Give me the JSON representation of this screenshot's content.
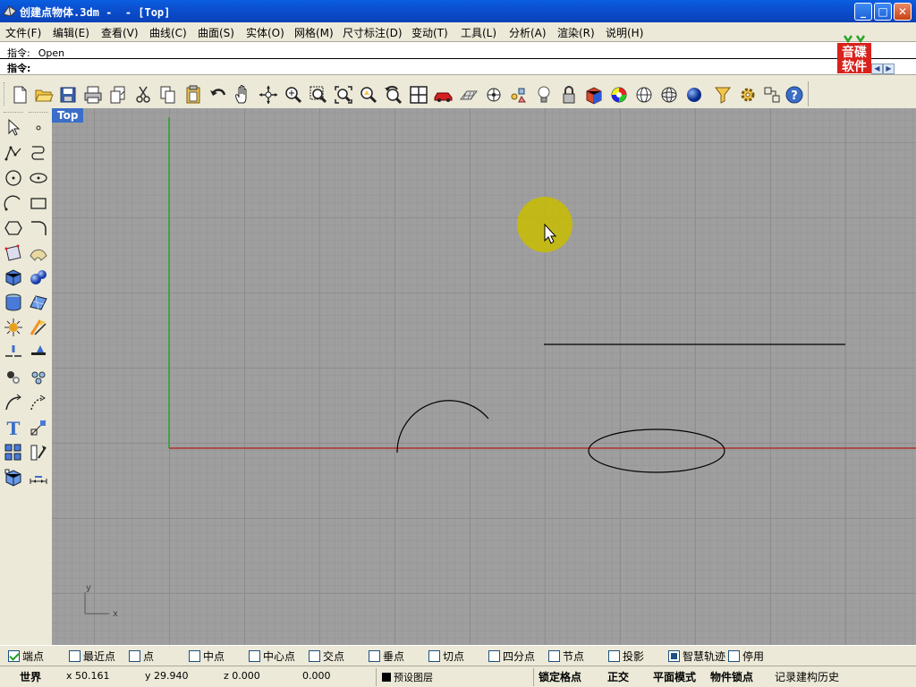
{
  "window": {
    "title": "创建点物体.3dm -  - [Top]",
    "minimize": "_",
    "maximize": "□",
    "close": "✕"
  },
  "menu": {
    "items": [
      "文件(F)",
      "编辑(E)",
      "查看(V)",
      "曲线(C)",
      "曲面(S)",
      "实体(O)",
      "网格(M)",
      "尺寸标注(D)",
      "变动(T)",
      "工具(L)",
      "分析(A)",
      "渲染(R)",
      "说明(H)"
    ]
  },
  "command": {
    "history": "指令: _Open",
    "prompt": "指令:",
    "input_value": ""
  },
  "logo": {
    "line1": "音碟",
    "line2": "软件"
  },
  "toolbar": {
    "icons": [
      "new-file-icon",
      "open-folder-icon",
      "save-icon",
      "print-icon",
      "import-icon",
      "cut-icon",
      "copy-icon",
      "paste-icon",
      "undo-icon",
      "pan-hand-icon",
      "rotate-view-icon",
      "zoom-dynamic-icon",
      "zoom-window-icon",
      "zoom-extents-icon",
      "zoom-selected-icon",
      "undo-view-icon",
      "four-viewports-icon",
      "car-icon",
      "grid-plane-icon",
      "construction-plane-icon",
      "objects-icon",
      "light-bulb-icon",
      "lock-icon",
      "shade-icon",
      "color-wheel-icon",
      "wireframe-sphere-icon",
      "grid-sphere-icon",
      "render-sphere-icon",
      "select-filter-icon",
      "settings-gear-icon",
      "options-icon",
      "help-icon"
    ]
  },
  "left_tools": {
    "icons": [
      "select-arrow-icon",
      "point-icon",
      "polyline-icon",
      "curve-blend-icon",
      "circle-icon",
      "ellipse-icon",
      "arc-icon",
      "rectangle-icon",
      "polygon-icon",
      "fillet-icon",
      "surface-point-icon",
      "surface-icon",
      "box-icon",
      "sphere-icon",
      "cylinder-icon",
      "surface-patch-icon",
      "explode-icon",
      "trim-icon",
      "split-icon",
      "boolean-icon",
      "group-icon",
      "curve-offset-icon",
      "curve-tools-icon",
      "transform-icon",
      "text-icon",
      "scale-icon",
      "array-icon",
      "align-icon",
      "block-icon",
      "dimension-icon"
    ]
  },
  "viewport": {
    "label": "Top",
    "axis_x": "x",
    "axis_y": "y"
  },
  "osnap": {
    "items": [
      {
        "label": "端点",
        "state": "checked"
      },
      {
        "label": "最近点",
        "state": "off"
      },
      {
        "label": "点",
        "state": "off"
      },
      {
        "label": "中点",
        "state": "off"
      },
      {
        "label": "中心点",
        "state": "off"
      },
      {
        "label": "交点",
        "state": "off"
      },
      {
        "label": "垂点",
        "state": "off"
      },
      {
        "label": "切点",
        "state": "off"
      },
      {
        "label": "四分点",
        "state": "off"
      },
      {
        "label": "节点",
        "state": "off"
      },
      {
        "label": "投影",
        "state": "off"
      },
      {
        "label": "智慧轨迹",
        "state": "filled"
      },
      {
        "label": "停用",
        "state": "off"
      }
    ]
  },
  "status": {
    "world": "世界",
    "x": "x 50.161",
    "y": "y 29.940",
    "z": "z 0.000",
    "w": "0.000",
    "layer": "预设图层",
    "snap": "锁定格点",
    "ortho": "正交",
    "planar": "平面模式",
    "osnap": "物件锁点",
    "history": "记录建构历史"
  },
  "colors": {
    "titlebar": "#0b4fd0",
    "viewport_bg": "#9f9f9f",
    "axis_x": "#b0302a",
    "axis_y": "#29a030",
    "cursor_highlight": "#d4c800"
  }
}
